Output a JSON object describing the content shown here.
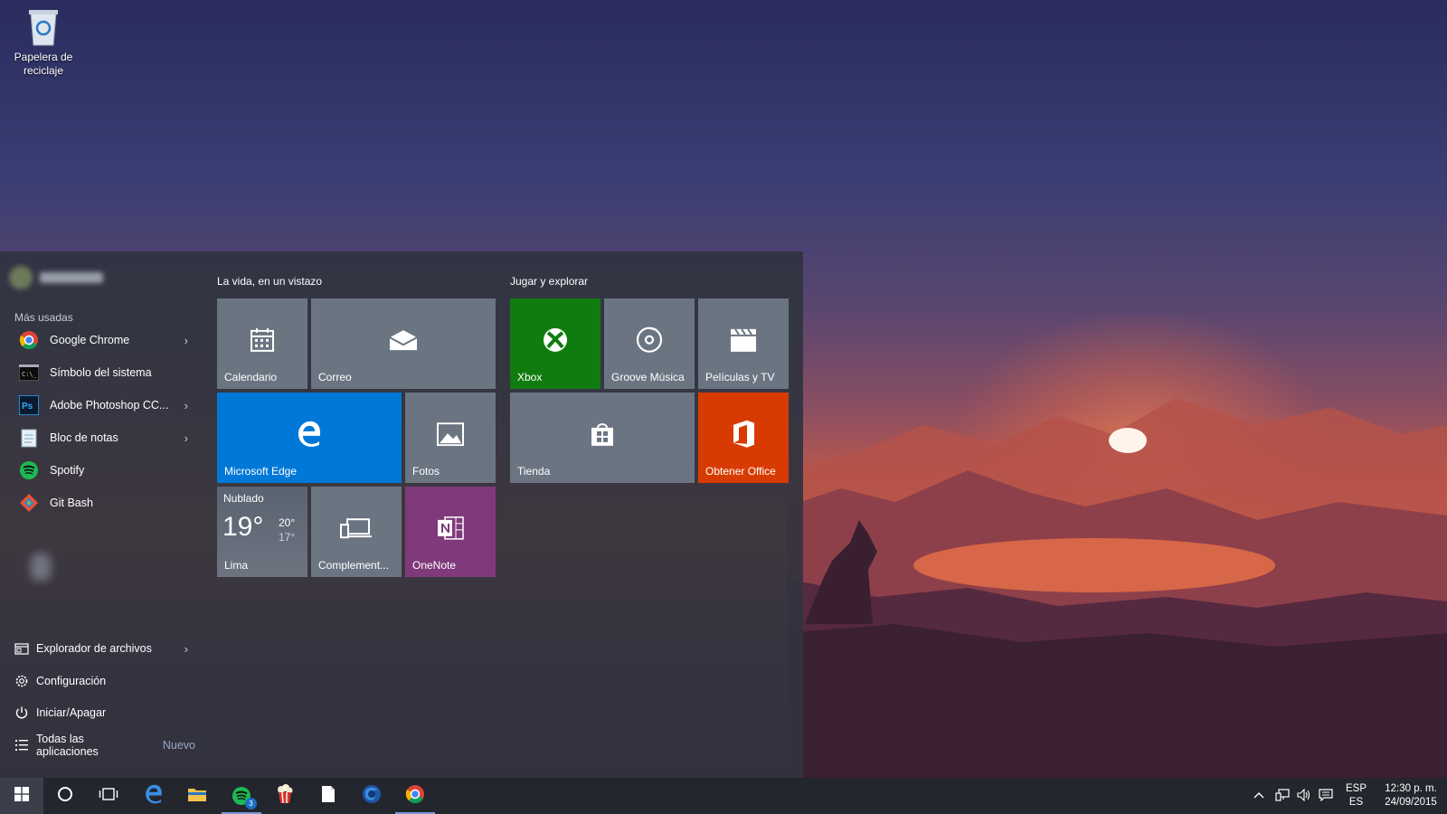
{
  "desktop": {
    "recycle_bin": {
      "line1": "Papelera de",
      "line2": "reciclaje"
    }
  },
  "start_menu": {
    "most_used_header": "Más usadas",
    "apps": [
      {
        "label": "Google Chrome",
        "icon": "chrome-icon",
        "has_submenu": true
      },
      {
        "label": "Símbolo del sistema",
        "icon": "command-prompt-icon",
        "has_submenu": false
      },
      {
        "label": "Adobe Photoshop CC...",
        "icon": "photoshop-icon",
        "has_submenu": true
      },
      {
        "label": "Bloc de notas",
        "icon": "notepad-icon",
        "has_submenu": true
      },
      {
        "label": "Spotify",
        "icon": "spotify-icon",
        "has_submenu": false
      },
      {
        "label": "Git Bash",
        "icon": "git-bash-icon",
        "has_submenu": false
      }
    ],
    "system": {
      "explorer": "Explorador de archivos",
      "settings": "Configuración",
      "power": "Iniciar/Apagar",
      "all_apps": "Todas las aplicaciones",
      "all_apps_badge": "Nuevo"
    },
    "groups": [
      {
        "title": "La vida, en un vistazo"
      },
      {
        "title": "Jugar y explorar"
      }
    ],
    "tiles": {
      "calendar": "Calendario",
      "mail": "Correo",
      "edge": "Microsoft Edge",
      "photos": "Fotos",
      "weather": {
        "condition": "Nublado",
        "temp": "19°",
        "high": "20°",
        "low": "17°",
        "city": "Lima"
      },
      "complements": "Complement...",
      "onenote": "OneNote",
      "xbox": "Xbox",
      "groove": "Groove Música",
      "movies": "Películas y TV",
      "store": "Tienda",
      "office": "Obtener Office"
    }
  },
  "taskbar": {
    "spotify_badge": "3",
    "lang_top": "ESP",
    "lang_bottom": "ES",
    "time": "12:30 p. m.",
    "date": "24/09/2015"
  },
  "colors": {
    "edge_blue": "#0078d7",
    "xbox_green": "#107c10",
    "office_orange": "#d83b01",
    "onenote_purple": "#80397b",
    "tile_grey": "#6b7582"
  }
}
